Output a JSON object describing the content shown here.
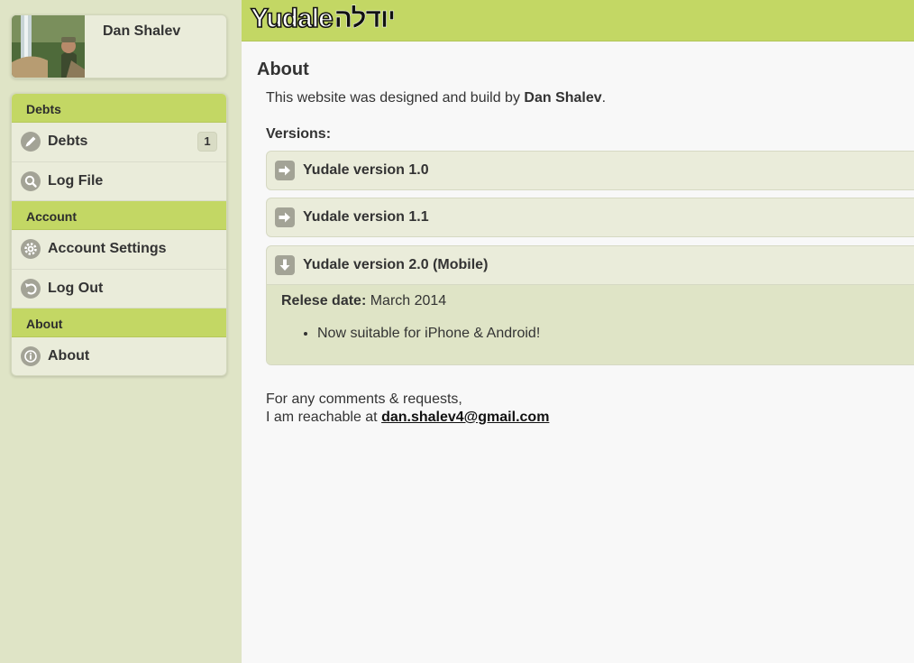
{
  "profile": {
    "name": "Dan Shalev"
  },
  "menu": {
    "sections": [
      {
        "header": "Debts",
        "items": [
          {
            "label": "Debts",
            "icon": "pencil-icon",
            "count": "1"
          },
          {
            "label": "Log File",
            "icon": "search-icon"
          }
        ]
      },
      {
        "header": "Account",
        "items": [
          {
            "label": "Account Settings",
            "icon": "gear-icon"
          },
          {
            "label": "Log Out",
            "icon": "undo-icon"
          }
        ]
      },
      {
        "header": "About",
        "items": [
          {
            "label": "About",
            "icon": "info-icon"
          }
        ]
      }
    ]
  },
  "header": {
    "logo_en": "Yudale",
    "logo_he": "יודלה"
  },
  "main": {
    "title": "About",
    "intro_prefix": "This website was designed and build by ",
    "intro_name": "Dan Shalev",
    "intro_suffix": ".",
    "versions_label": "Versions:",
    "versions": [
      {
        "title": "Yudale version 1.0",
        "expanded": false
      },
      {
        "title": "Yudale version 1.1",
        "expanded": false
      },
      {
        "title": "Yudale version 2.0 (Mobile)",
        "expanded": true,
        "release_label": "Relese date:",
        "release_value": " March 2014",
        "features": [
          "Now suitable for iPhone & Android!"
        ]
      }
    ],
    "contact_line1": "For any comments & requests,",
    "contact_line2": "I am reachable at ",
    "contact_email": "dan.shalev4@gmail.com"
  },
  "colors": {
    "accent": "#c3d764",
    "sidebar_bg": "#dfe4c6",
    "panel_bg": "#eaecda",
    "icon_gray": "#a3a396"
  }
}
